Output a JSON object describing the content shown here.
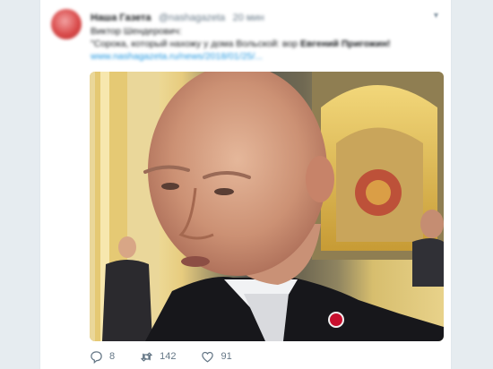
{
  "tweet": {
    "author_name": "Наша Газета",
    "author_handle": "@nashagazeta",
    "timestamp": "20 мин",
    "line1": "Виктор Шендерович:",
    "line2_prefix": "\"Сорока, который нахожу у дома Вольской: вор",
    "line2_bold": "Евгений Пригожин!",
    "link": "www.nashagazeta.ru/news/2018/01/25/..."
  },
  "actions": {
    "reply_count": "8",
    "retweet_count": "142",
    "like_count": "91"
  },
  "icons": {
    "reply": "reply-icon",
    "retweet": "retweet-icon",
    "like": "heart-icon",
    "more": "chevron-down-icon"
  },
  "colors": {
    "link": "#1b95e0",
    "muted": "#657786",
    "text": "#14171a",
    "badge_red": "#c8102e"
  }
}
